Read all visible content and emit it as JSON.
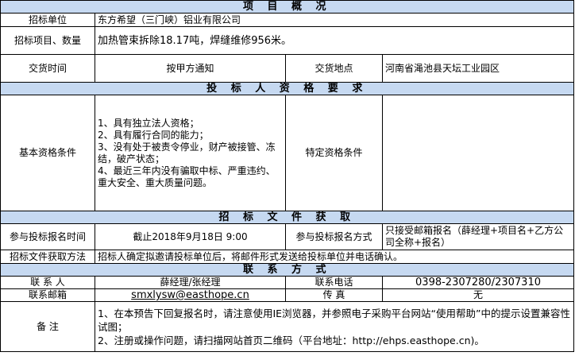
{
  "sections": {
    "overview": "项 目 概 况",
    "qualification": "投 标 人 资 格 要 求",
    "documents": "招 标 文 件 获 取",
    "contact": "联 系 方 式"
  },
  "overview": {
    "bidder_label": "招标单位",
    "bidder_value": "东方希望（三门峡）铝业有限公司",
    "project_label": "招标项目、数量",
    "project_value": "加热管束拆除18.17吨，焊缝维修956米。",
    "delivery_time_label": "交货时间",
    "delivery_time_value": "按甲方通知",
    "delivery_place_label": "交货地点",
    "delivery_place_value": "河南省渑池县天坛工业园区"
  },
  "qualification": {
    "basic_label": "基本资格条件",
    "basic_value": "1、具有独立法人资格；\n2、具有履行合同的能力；\n3、没有处于被责令停业，财产被接管、冻结，破产状态；\n4、最近三年内没有骗取中标、严重违约、重大安全、重大质量问题。",
    "special_label": "特定资格条件",
    "special_value": ""
  },
  "documents": {
    "reg_time_label": "参与投标报名时间",
    "reg_time_value": "截止2018年9月18日 9:00",
    "reg_method_label": "参与投标报名方式",
    "reg_method_value": "只接受邮箱报名（薛经理+项目名+乙方公司全称+报名）",
    "obtain_label": "招标文件获取方法",
    "obtain_value": "招标人确定拟邀请投标单位后，将邮件形式发送给投标单位并电话确认。"
  },
  "contact": {
    "person_label": "联 系 人",
    "person_value": "薛经理/张经理",
    "phone_label": "联系电话",
    "phone_value": "0398-2307280/2307310",
    "email_label": "联系邮箱",
    "email_value": "smxlysw@easthope.cn",
    "fax_label": "传    真",
    "fax_value": "无",
    "notes_label": "备    注",
    "notes_value": "1、在本预告下回复报名时，请注意使用IE浏览器，并参照电子采购平台网站“使用帮助”中的提示设置兼容性试图；\n2、注册或操作问题，请扫描网站首页二维码（平台地址：http://ehps.easthope.cn)。"
  }
}
